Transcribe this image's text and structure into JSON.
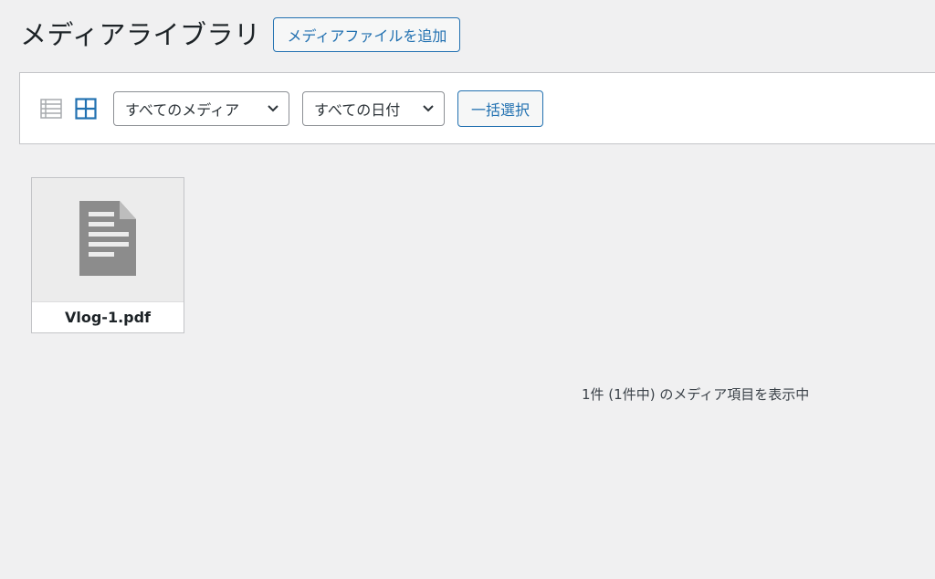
{
  "header": {
    "title": "メディアライブラリ",
    "add_new_label": "メディアファイルを追加"
  },
  "toolbar": {
    "view_list_icon": "list-view-icon",
    "view_grid_icon": "grid-view-icon",
    "media_filter": {
      "selected": "すべてのメディア"
    },
    "date_filter": {
      "selected": "すべての日付"
    },
    "bulk_select_label": "一括選択"
  },
  "attachments": [
    {
      "filename": "Vlog-1.pdf",
      "icon": "document-icon"
    }
  ],
  "footer": {
    "count_text": "1件 (1件中) のメディア項目を表示中"
  },
  "colors": {
    "accent": "#2271b1",
    "background": "#f0f0f1",
    "icon_gray": "#8c8f94"
  }
}
